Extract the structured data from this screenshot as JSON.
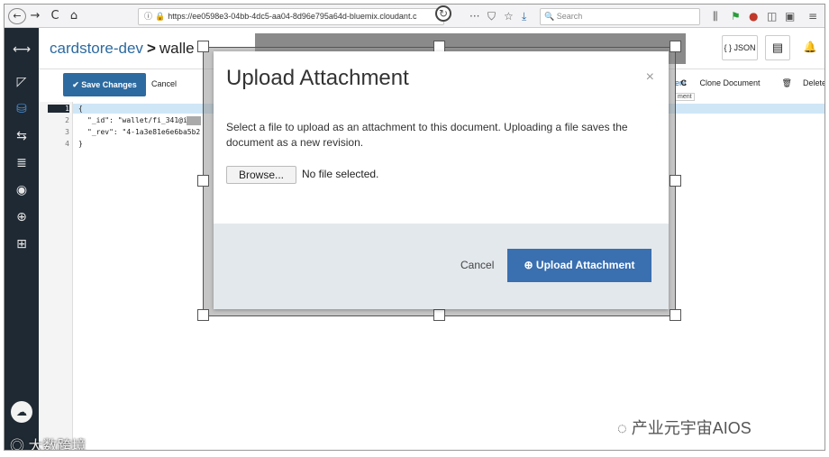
{
  "browser": {
    "back": "←",
    "forward": "→",
    "reload": "C",
    "home": "⌂",
    "url": "https://ee0598e3-04bb-4dc5-aa04-8d96e795a64d-bluemix.cloudant.c",
    "more": "···",
    "search_placeholder": "Search"
  },
  "sidebar": {
    "items": [
      "⟷",
      "◸",
      "⛁",
      "⇆",
      "≣",
      "◉",
      "⊕",
      "⊞"
    ]
  },
  "header": {
    "database": "cardstore-dev",
    "separator": ">",
    "doc_prefix": "walle",
    "json_button": "{ } JSON",
    "docs_icon": "▤",
    "bell_icon": "🔔"
  },
  "toolbar": {
    "save_label": "Save Changes",
    "cancel_label": "Cancel",
    "clip_label": "ent",
    "clip_tip": "ment",
    "clone_label": "Clone Document",
    "delete_label": "Delete"
  },
  "editor": {
    "lines": [
      {
        "n": "1",
        "text": "{"
      },
      {
        "n": "2",
        "text": "\"_id\": \"wallet/fi_341@i"
      },
      {
        "n": "3",
        "text": "\"_rev\": \"4-1a3e81e6e6ba5b2"
      },
      {
        "n": "4",
        "text": "}"
      }
    ]
  },
  "modal": {
    "title": "Upload Attachment",
    "close": "×",
    "description": "Select a file to upload as an attachment to this document. Uploading a file saves the document as a new revision.",
    "browse_label": "Browse...",
    "file_status": "No file selected.",
    "cancel_label": "Cancel",
    "upload_label": "Upload Attachment"
  },
  "watermarks": {
    "left": "大数跨境",
    "right": "产业元宇宙AIOS"
  }
}
